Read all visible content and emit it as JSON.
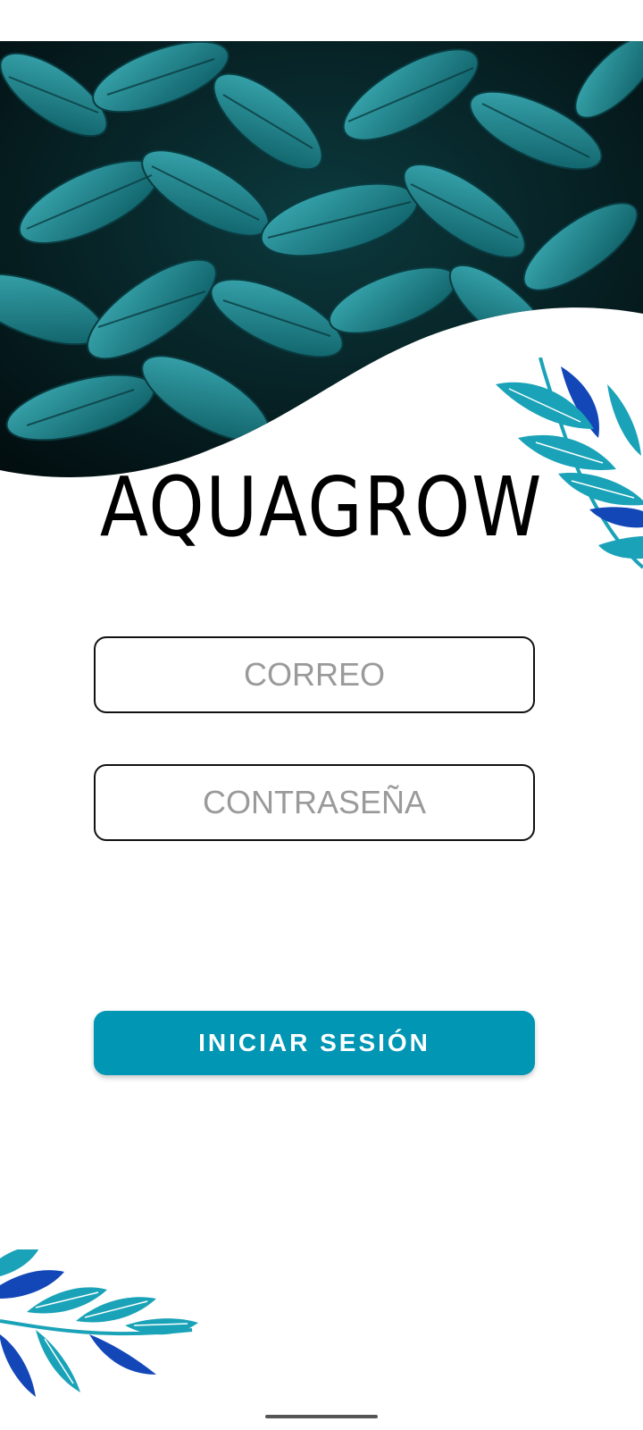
{
  "app": {
    "title": "AQUAGROW"
  },
  "login": {
    "email_placeholder": "CORREO",
    "password_placeholder": "CONTRASEÑA",
    "submit_label": "INICIAR SESIÓN"
  },
  "colors": {
    "accent": "#0096b4",
    "leaf_teal": "#1aa3b8",
    "leaf_blue": "#1347b8",
    "hero_dark": "#041a1c"
  }
}
